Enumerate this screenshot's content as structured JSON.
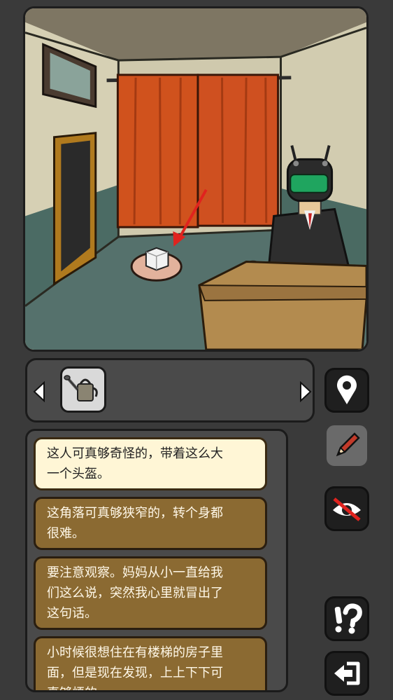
{
  "scene": {
    "description_items": [
      "picture-frame",
      "door",
      "curtain",
      "robot-man",
      "desk",
      "pedestal",
      "sugar-cube"
    ],
    "pointer_arrow_color": "#e0231e"
  },
  "inventory": {
    "items": [
      {
        "name": "watering-can"
      }
    ],
    "prev_icon": "left-arrow-icon",
    "next_icon": "right-arrow-icon"
  },
  "side_buttons": [
    {
      "name": "map-pin-button",
      "icon": "map-pin-icon"
    },
    {
      "name": "pencil-button",
      "icon": "pencil-icon"
    },
    {
      "name": "eye-off-button",
      "icon": "eye-crossed-icon"
    },
    {
      "name": "hint-button",
      "icon": "exclamation-question-icon"
    },
    {
      "name": "exit-button",
      "icon": "exit-arrow-icon"
    }
  ],
  "dialog": {
    "lines": [
      {
        "text": "这人可真够奇怪的，带着这么大一个头盔。",
        "line1": "这人可真够奇怪的，带着这么大",
        "line2": "一个头盔。"
      },
      {
        "text": "这角落可真够狭窄的，转个身都很难。",
        "line1": "这角落可真够狭窄的，转个身都",
        "line2": "很难。"
      },
      {
        "text": "要注意观察。妈妈从小一直给我们这么说，突然我心里就冒出了这句话。",
        "line1": "要注意观察。妈妈从小一直给我",
        "line2": "们这么说，突然我心里就冒出了",
        "line3": "这句话。"
      },
      {
        "text": "小时候很想住在有楼梯的房子里面，但是现在发现，上上下下可真够烦的。",
        "line1": "小时候很想住在有楼梯的房子里",
        "line2": "面，但是现在发现，上上下下可",
        "line3": "真够烦的。"
      }
    ]
  }
}
